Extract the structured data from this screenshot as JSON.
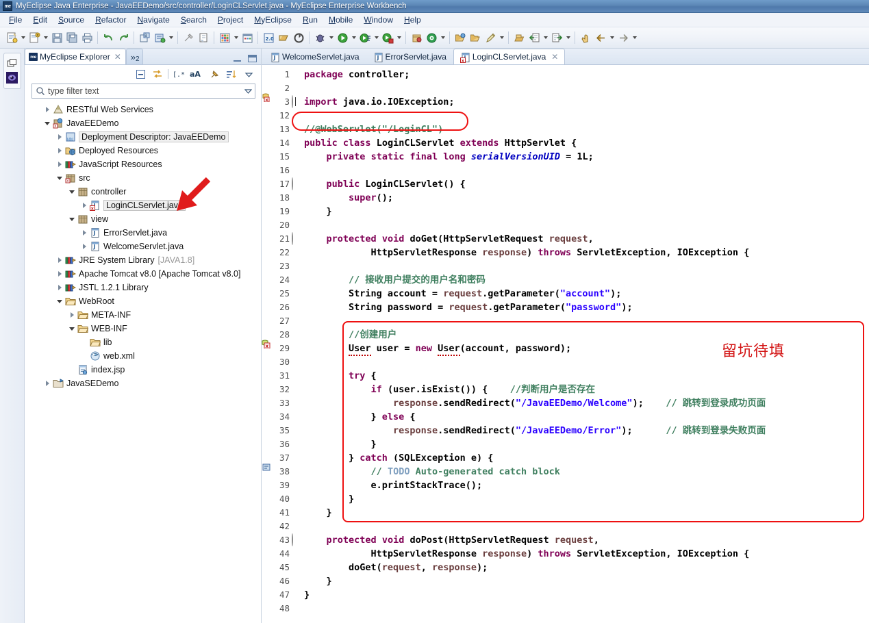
{
  "window": {
    "title": "MyEclipse Java Enterprise - JavaEEDemo/src/controller/LoginCLServlet.java - MyEclipse Enterprise Workbench",
    "app_badge": "me"
  },
  "menubar": {
    "items": [
      {
        "label": "File"
      },
      {
        "label": "Edit"
      },
      {
        "label": "Source"
      },
      {
        "label": "Refactor"
      },
      {
        "label": "Navigate"
      },
      {
        "label": "Search"
      },
      {
        "label": "Project"
      },
      {
        "label": "MyEclipse"
      },
      {
        "label": "Run"
      },
      {
        "label": "Mobile"
      },
      {
        "label": "Window"
      },
      {
        "label": "Help"
      }
    ]
  },
  "toolbar": {
    "groups": [
      [
        "new-wizard-icon",
        "dropdown",
        "new-java-project-icon",
        "dropdown",
        "save-icon",
        "save-all-icon",
        "print-icon"
      ],
      [
        "undo-icon",
        "redo-icon"
      ],
      [
        "build-all-icon",
        "debug-deploy-icon",
        "dropdown"
      ],
      [
        "external-tools-icon",
        "open-type-icon"
      ],
      [
        "table-grid-icon",
        "dropdown",
        "calendar-icon"
      ],
      [
        "web-20-icon",
        "open-perspective-icon",
        "refresh-run-icon"
      ],
      [
        "debug-icon",
        "dropdown",
        "run-icon",
        "dropdown",
        "run-config-icon",
        "dropdown",
        "coverage-icon",
        "dropdown"
      ],
      [
        "package-icon",
        "target-icon",
        "dropdown"
      ],
      [
        "open-folder-icon",
        "open-file-icon",
        "edit-pencil-icon",
        "dropdown"
      ],
      [
        "archive-icon",
        "import-icon",
        "dropdown",
        "export-icon",
        "dropdown"
      ],
      [
        "back-hand-icon",
        "prev-arrow-icon",
        "dropdown",
        "next-arrow-icon",
        "dropdown"
      ]
    ]
  },
  "left_rail": {
    "icons": [
      "restore-view-icon",
      "myeclipse-perspective-icon"
    ]
  },
  "explorer": {
    "tab_label": "MyEclipse Explorer",
    "tab_badge": "me",
    "overflow_count": "2",
    "overflow_chevron": "»",
    "tools": [
      "collapse-all-icon",
      "link-with-editor-icon",
      "filter-regex-icon",
      "case-sensitive-icon",
      "pin-icon",
      "sort-icon",
      "view-menu-icon"
    ],
    "filter": {
      "placeholder": "type filter text",
      "value": ""
    },
    "tree": [
      {
        "indent": 1,
        "twist": "collapsed",
        "icon": "restful-icon",
        "label": "RESTful Web Services",
        "suffix": "",
        "state": "normal"
      },
      {
        "indent": 1,
        "twist": "expanded",
        "icon": "webproject-icon",
        "label": "JavaEEDemo",
        "suffix": "",
        "state": "normal"
      },
      {
        "indent": 2,
        "twist": "collapsed",
        "icon": "deploydesc-icon",
        "label": "Deployment Descriptor: JavaEEDemo",
        "suffix": "",
        "state": "boxed"
      },
      {
        "indent": 2,
        "twist": "collapsed",
        "icon": "deployedres-icon",
        "label": "Deployed Resources",
        "suffix": "",
        "state": "normal"
      },
      {
        "indent": 2,
        "twist": "collapsed",
        "icon": "library-icon",
        "label": "JavaScript Resources",
        "suffix": "",
        "state": "normal"
      },
      {
        "indent": 2,
        "twist": "expanded",
        "icon": "srcfolder-icon",
        "label": "src",
        "suffix": "",
        "state": "normal"
      },
      {
        "indent": 3,
        "twist": "expanded",
        "icon": "package-icon",
        "label": "controller",
        "suffix": "",
        "state": "normal"
      },
      {
        "indent": 4,
        "twist": "collapsed",
        "icon": "java-error-icon",
        "label": "LoginCLServlet.java",
        "suffix": "",
        "state": "sel"
      },
      {
        "indent": 3,
        "twist": "expanded",
        "icon": "package-icon",
        "label": "view",
        "suffix": "",
        "state": "normal"
      },
      {
        "indent": 4,
        "twist": "collapsed",
        "icon": "java-icon",
        "label": "ErrorServlet.java",
        "suffix": "",
        "state": "normal"
      },
      {
        "indent": 4,
        "twist": "collapsed",
        "icon": "java-icon",
        "label": "WelcomeServlet.java",
        "suffix": "",
        "state": "normal"
      },
      {
        "indent": 2,
        "twist": "collapsed",
        "icon": "library-icon",
        "label": "JRE System Library",
        "suffix": "[JAVA1.8]",
        "state": "normal"
      },
      {
        "indent": 2,
        "twist": "collapsed",
        "icon": "library-icon",
        "label": "Apache Tomcat v8.0 [Apache Tomcat v8.0]",
        "suffix": "",
        "state": "normal"
      },
      {
        "indent": 2,
        "twist": "collapsed",
        "icon": "library-icon",
        "label": "JSTL 1.2.1 Library",
        "suffix": "",
        "state": "normal"
      },
      {
        "indent": 2,
        "twist": "expanded",
        "icon": "folder-icon",
        "label": "WebRoot",
        "suffix": "",
        "state": "normal"
      },
      {
        "indent": 3,
        "twist": "collapsed",
        "icon": "folder-icon",
        "label": "META-INF",
        "suffix": "",
        "state": "normal"
      },
      {
        "indent": 3,
        "twist": "expanded",
        "icon": "folder-icon",
        "label": "WEB-INF",
        "suffix": "",
        "state": "normal"
      },
      {
        "indent": 4,
        "twist": "none",
        "icon": "folder-icon",
        "label": "lib",
        "suffix": "",
        "state": "normal"
      },
      {
        "indent": 4,
        "twist": "none",
        "icon": "xml-icon",
        "label": "web.xml",
        "suffix": "",
        "state": "normal"
      },
      {
        "indent": 3,
        "twist": "none",
        "icon": "jsp-icon",
        "label": "index.jsp",
        "suffix": "",
        "state": "normal"
      },
      {
        "indent": 1,
        "twist": "collapsed",
        "icon": "javaproject-icon",
        "label": "JavaSEDemo",
        "suffix": "",
        "state": "normal"
      }
    ]
  },
  "editor": {
    "tabs": [
      {
        "label": "WelcomeServlet.java",
        "icon": "java-icon",
        "active": false,
        "closable": false
      },
      {
        "label": "ErrorServlet.java",
        "icon": "java-icon",
        "active": false,
        "closable": false
      },
      {
        "label": "LoginCLServlet.java",
        "icon": "java-error-icon",
        "active": true,
        "closable": true
      }
    ],
    "line_numbers": [
      "1",
      "2",
      "3",
      "12",
      "13",
      "14",
      "15",
      "16",
      "17",
      "18",
      "19",
      "20",
      "21",
      "22",
      "23",
      "24",
      "25",
      "26",
      "27",
      "28",
      "29",
      "30",
      "31",
      "32",
      "33",
      "34",
      "35",
      "36",
      "37",
      "38",
      "39",
      "40",
      "41",
      "42",
      "43",
      "44",
      "45",
      "46",
      "47",
      "48"
    ],
    "fold_markers": {
      "3": "plus",
      "17": "minus",
      "21": "minus",
      "43": "minus"
    },
    "gutter_markers": {
      "3": "warning",
      "29": "error",
      "38": "todo"
    },
    "overview_markers": {
      "21": "up-triangle",
      "43": "up-triangle"
    },
    "code_lines": [
      "package controller;",
      "",
      "import java.io.IOException;",
      "",
      "//@WebServlet(\"/LoginCL\")",
      "public class LoginCLServlet extends HttpServlet {",
      "    private static final long serialVersionUID = 1L;",
      "",
      "    public LoginCLServlet() {",
      "        super();",
      "    }",
      "",
      "    protected void doGet(HttpServletRequest request,",
      "            HttpServletResponse response) throws ServletException, IOException {",
      "",
      "        // 接收用户提交的用户名和密码",
      "        String account = request.getParameter(\"account\");",
      "        String password = request.getParameter(\"password\");",
      "",
      "        //创建用户",
      "        User user = new User(account, password);",
      "",
      "        try {",
      "            if (user.isExist()) {    //判断用户是否存在",
      "                response.sendRedirect(\"/JavaEEDemo/Welcome\");    // 跳转到登录成功页面",
      "            } else {",
      "                response.sendRedirect(\"/JavaEEDemo/Error\");      // 跳转到登录失败页面",
      "            }",
      "        } catch (SQLException e) {",
      "            // TODO Auto-generated catch block",
      "            e.printStackTrace();",
      "        }",
      "    }",
      "",
      "    protected void doPost(HttpServletRequest request,",
      "            HttpServletResponse response) throws ServletException, IOException {",
      "        doGet(request, response);",
      "    }",
      "}",
      ""
    ]
  },
  "annotations": {
    "red_note_text": "留坑待填",
    "red_note_color": "#d31515",
    "oval_target": "//@WebServlet(\"/LoginCL\")",
    "box_target": "try-catch block",
    "arrow_target": "LoginCLServlet.java"
  }
}
